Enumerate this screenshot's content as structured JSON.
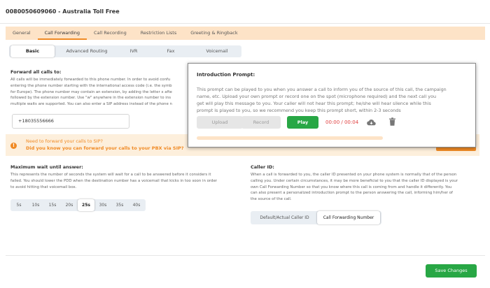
{
  "header": {
    "title": "0080050609060 - Australia Toll Free"
  },
  "tabs": [
    {
      "label": "General"
    },
    {
      "label": "Call Forwarding",
      "active": true
    },
    {
      "label": "Call Recording"
    },
    {
      "label": "Restriction Lists"
    },
    {
      "label": "Greeting & Ringback"
    }
  ],
  "subtabs": [
    {
      "label": "Basic",
      "active": true
    },
    {
      "label": "Advanced Routing"
    },
    {
      "label": "IVR"
    },
    {
      "label": "Fax"
    },
    {
      "label": "Voicemail"
    }
  ],
  "forward": {
    "title": "Forward all calls to:",
    "description": [
      "All calls will be immediately forwarded to this phone number. In order to avoid confu",
      "entering the phone number starting with the international access code (i.e. the symb",
      "for Europe). The phone number may contain an extension, by adding the letter x afte",
      "followed by the extension number. Use \"w\" anywhere in the extension number to ins",
      "multiple waits are supported. You can also enter a SIP address instead of the phone n"
    ],
    "phone_value": "+18035556666"
  },
  "sip_banner": {
    "line1": "Need to forward your calls to SIP?",
    "line2": "Did you know you can forward your calls to your PBX via SIP?"
  },
  "max_wait": {
    "title": "Maximum wait until answer:",
    "description": [
      "This represents the number of seconds the system will wait for a call to be answered before it considers it",
      "failed. You should lower the PDD when the destination number has a voicemail that kicks in too soon in order",
      "to avoid hitting that voicemail box."
    ],
    "options": [
      "5s",
      "10s",
      "15s",
      "20s",
      "25s",
      "30s",
      "35s",
      "40s"
    ],
    "selected_index": 4
  },
  "caller_id": {
    "title": "Caller ID:",
    "description": [
      "When a call is forwarded to you, the caller ID presented on your phone system is normally that of the person",
      "calling you. Under certain circumstances, it may be more beneficial to you that the caller ID displayed is your",
      "own Call Forwarding Number so that you know where this call is coming from and handle it differently. You",
      "can also present a personalized introduction prompt to the person answering the call, informing him/her of",
      "the source of the call."
    ],
    "options": [
      "Default/Actual Caller ID",
      "Call Forwarding Number"
    ],
    "selected_index": 1
  },
  "save_label": "Save Changes",
  "popup": {
    "title": "Introduction Prompt:",
    "text": [
      "This prompt can be played to you when you answer a call to inform you of the source of this call, the campaign",
      "name, etc. Upload your own prompt or record one on the spot (microphone required) and the next call you",
      "get will play this message to you. Your caller will not hear this prompt; he/she will hear silence while this",
      "prompt is played to you, so we recommend you keep this prompt short, within 2-3 seconds"
    ],
    "upload_label": "Upload",
    "record_label": "Record",
    "play_label": "Play",
    "timer": "00:00 / 00:04",
    "progress": 0.0
  },
  "colors": {
    "accent": "#f08a24",
    "success": "#28a745",
    "timer": "#e04040"
  }
}
